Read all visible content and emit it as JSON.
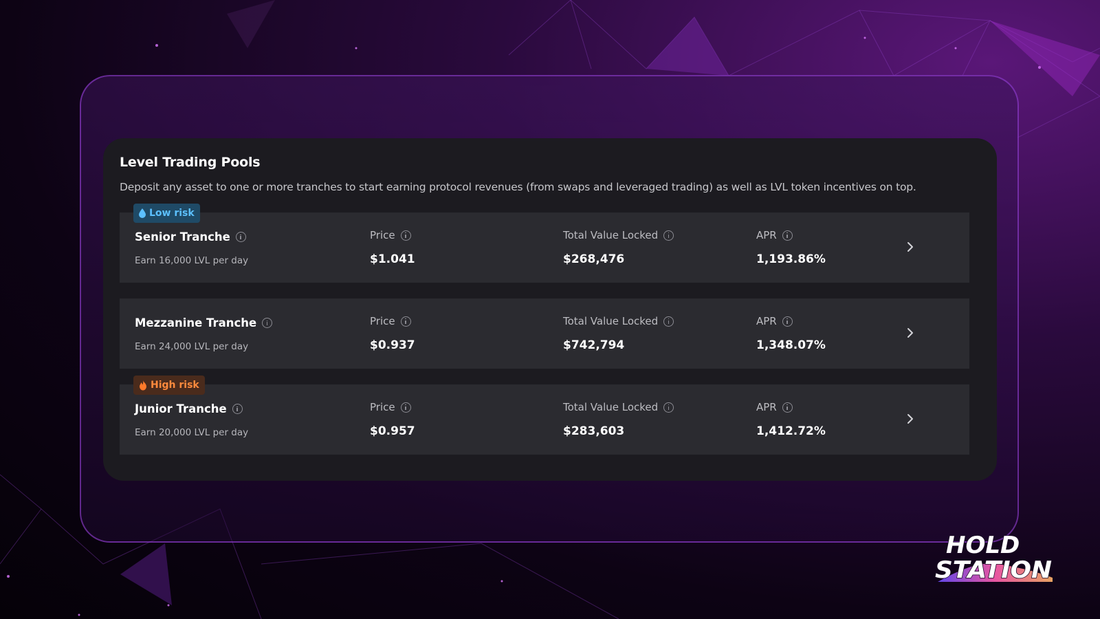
{
  "panel": {
    "title": "Level Trading Pools",
    "description": "Deposit any asset to one or more tranches to start earning protocol revenues (from swaps and leveraged trading) as well as LVL token incentives on top."
  },
  "badges": {
    "low": {
      "label": "Low risk",
      "icon": "water-drop-icon",
      "color": "#5cc0ff"
    },
    "high": {
      "label": "High risk",
      "icon": "fire-icon",
      "color": "#ff8a3d"
    }
  },
  "columns": {
    "price": "Price",
    "tvl": "Total Value Locked",
    "apr": "APR"
  },
  "tranches": [
    {
      "name": "Senior Tranche",
      "earn": "Earn 16,000 LVL per day",
      "price": "$1.041",
      "tvl": "$268,476",
      "apr": "1,193.86%"
    },
    {
      "name": "Mezzanine Tranche",
      "earn": "Earn 24,000 LVL per day",
      "price": "$0.937",
      "tvl": "$742,794",
      "apr": "1,348.07%"
    },
    {
      "name": "Junior Tranche",
      "earn": "Earn 20,000 LVL per day",
      "price": "$0.957",
      "tvl": "$283,603",
      "apr": "1,412.72%"
    }
  ],
  "logo": {
    "line1": "HOLD",
    "line2": "STATION"
  },
  "colors": {
    "background": "#0d0314",
    "panel": "#1c1b20",
    "row": "#2b2b30",
    "frame": "#a046e6"
  }
}
